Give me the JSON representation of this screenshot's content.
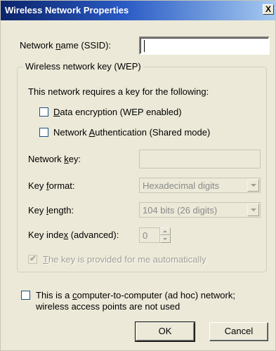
{
  "window": {
    "title": "Wireless Network Properties",
    "close_glyph": "X"
  },
  "ssid": {
    "label_pre": "Network ",
    "label_ul": "n",
    "label_post": "ame (SSID):",
    "value": ""
  },
  "group": {
    "title": "Wireless network key (WEP)",
    "description": "This network requires a key for the following:"
  },
  "data_encryption": {
    "label_ul": "D",
    "label_post": "ata encryption (WEP enabled)",
    "checked": false
  },
  "network_auth": {
    "label_pre": "Network ",
    "label_ul": "A",
    "label_post": "uthentication (Shared mode)",
    "checked": false
  },
  "network_key": {
    "label_pre": "Network ",
    "label_ul": "k",
    "label_post": "ey:",
    "value": ""
  },
  "key_format": {
    "label_pre": "Key ",
    "label_ul": "f",
    "label_post": "ormat:",
    "selected": "Hexadecimal digits"
  },
  "key_length": {
    "label_pre": "Key ",
    "label_ul": "l",
    "label_post": "ength:",
    "selected": "104 bits (26 digits)"
  },
  "key_index": {
    "label_pre": "Key inde",
    "label_ul": "x",
    "label_post": " (advanced):",
    "value": "0"
  },
  "auto_key": {
    "label_ul": "T",
    "label_post": "he key is provided for me automatically",
    "checked": true,
    "check_glyph": "✔"
  },
  "adhoc": {
    "line1_pre": "This is a ",
    "line1_ul": "c",
    "line1_post": "omputer-to-computer (ad hoc) network;",
    "line2": "wireless access points are not used",
    "checked": false
  },
  "buttons": {
    "ok": "OK",
    "cancel": "Cancel"
  },
  "colors": {
    "dialog_bg": "#ece9d8",
    "title_gradient_start": "#0b246a",
    "title_gradient_end": "#a6caf0",
    "disabled_text": "#8a8a8a"
  }
}
